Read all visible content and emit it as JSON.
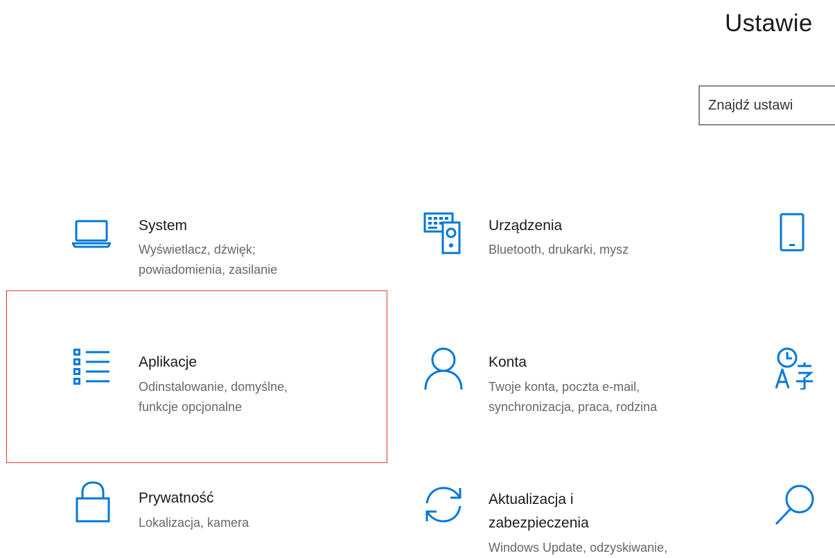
{
  "header": {
    "title": "Ustawie"
  },
  "search": {
    "placeholder": "Znajdź ustawi"
  },
  "tiles": [
    {
      "icon": "laptop-icon",
      "title": "System",
      "description": "Wyświetlacz, dźwięk;\npowiadomienia, zasilanie"
    },
    {
      "icon": "keyboard-speaker-icon",
      "title": "Urządzenia",
      "description": "Bluetooth, drukarki, mysz"
    },
    {
      "icon": "phone-icon",
      "title": "",
      "description": ""
    },
    {
      "icon": "app-list-icon",
      "title": "Aplikacje",
      "description": "Odinstalowanie, domyślne,\nfunkcje opcjonalne"
    },
    {
      "icon": "person-icon",
      "title": "Konta",
      "description": "Twoje konta, poczta e-mail,\nsynchronizacja, praca, rodzina"
    },
    {
      "icon": "time-language-icon",
      "title": "",
      "description": ""
    },
    {
      "icon": "lock-icon",
      "title": "Prywatność",
      "description": "Lokalizacja, kamera"
    },
    {
      "icon": "sync-arrows-icon",
      "title": "Aktualizacja i\nzabezpieczenia",
      "description": "Windows Update, odzyskiwanie,"
    },
    {
      "icon": "search-icon",
      "title": "",
      "description": ""
    }
  ],
  "colors": {
    "accent": "#0078d7",
    "highlight_frame": "#e53935",
    "title_text": "#1a1a1a",
    "description_text": "#666666",
    "search_border": "#8a8a8a"
  }
}
